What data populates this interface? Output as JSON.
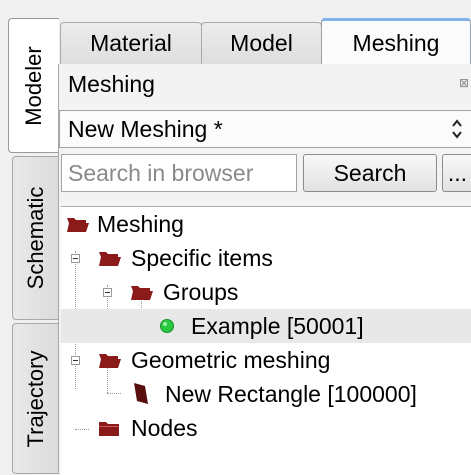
{
  "side_tabs": [
    {
      "label": "Modeler",
      "active": true
    },
    {
      "label": "Schematic",
      "active": false
    },
    {
      "label": "Trajectory",
      "active": false
    }
  ],
  "top_tabs": [
    {
      "label": "Material",
      "active": false
    },
    {
      "label": "Model",
      "active": false
    },
    {
      "label": "Meshing",
      "active": true
    }
  ],
  "panel": {
    "title": "Meshing",
    "combo_value": "New Meshing *"
  },
  "search": {
    "placeholder": "Search in browser",
    "button_label": "Search",
    "more_label": "..."
  },
  "tree": [
    {
      "label": "Meshing",
      "icon": "folder-open-icon"
    },
    {
      "label": "Specific items",
      "icon": "folder-open-icon",
      "expanded": true
    },
    {
      "label": "Groups",
      "icon": "folder-open-icon",
      "expanded": true
    },
    {
      "label": "Example [50001]",
      "icon": "green-dot-icon",
      "selected": true
    },
    {
      "label": "Geometric meshing",
      "icon": "folder-open-icon",
      "expanded": true
    },
    {
      "label": "New Rectangle [100000]",
      "icon": "surface-icon"
    },
    {
      "label": "Nodes",
      "icon": "folder-closed-icon"
    }
  ],
  "colors": {
    "folder": "#8b1a1a",
    "green_dot": "#27c93f",
    "active_tab_accent": "#7fb3e8"
  }
}
